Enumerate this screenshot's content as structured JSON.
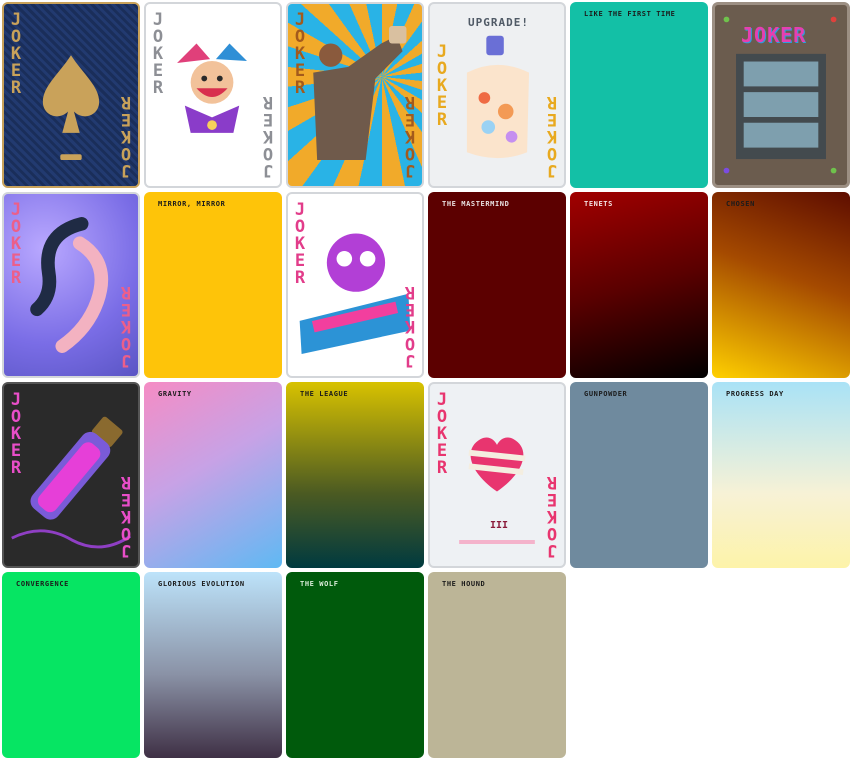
{
  "joker_text": "J\nO\nK\nE\nR",
  "decks": {
    "royal": {
      "label": ""
    },
    "jester": {
      "label": ""
    },
    "champion": {
      "label": ""
    },
    "upgrade": {
      "label": "",
      "banner": "UPGRADE!"
    },
    "first_time": {
      "label": "LIKE THE FIRST TIME"
    },
    "machine": {
      "label": "",
      "sign": "JOKER"
    },
    "koi": {
      "label": ""
    },
    "mirror": {
      "label": "MIRROR, MIRROR"
    },
    "graffiti": {
      "label": ""
    },
    "mastermind": {
      "label": "THE MASTERMIND"
    },
    "tenets": {
      "label": "TENETS"
    },
    "chosen": {
      "label": "CHOSEN"
    },
    "vial": {
      "label": ""
    },
    "gravity": {
      "label": "GRAVITY"
    },
    "league": {
      "label": "THE LEAGUE"
    },
    "heart": {
      "label": "",
      "numeral": "III"
    },
    "gunpowder": {
      "label": "GUNPOWDER"
    },
    "progress_day": {
      "label": "PROGRESS DAY"
    },
    "convergence": {
      "label": "CONVERGENCE"
    },
    "glorious": {
      "label": "GLORIOUS EVOLUTION"
    },
    "wolf": {
      "label": "THE WOLF"
    },
    "hound": {
      "label": "THE HOUND"
    }
  },
  "colors": {
    "navy": "#1f3566",
    "gold": "#c9a25a",
    "teal": "#13c0a6",
    "yellow": "#fec409",
    "slate": "#6f8a9e",
    "green": "#06e563",
    "dark_green": "#005a0c",
    "khaki": "#bcb597"
  },
  "icons": [
    "spade-icon",
    "jester-icon",
    "fist-icon",
    "upgrade-icon",
    "koi-icon",
    "graffiti-icon",
    "potion-icon",
    "heart-icon"
  ]
}
